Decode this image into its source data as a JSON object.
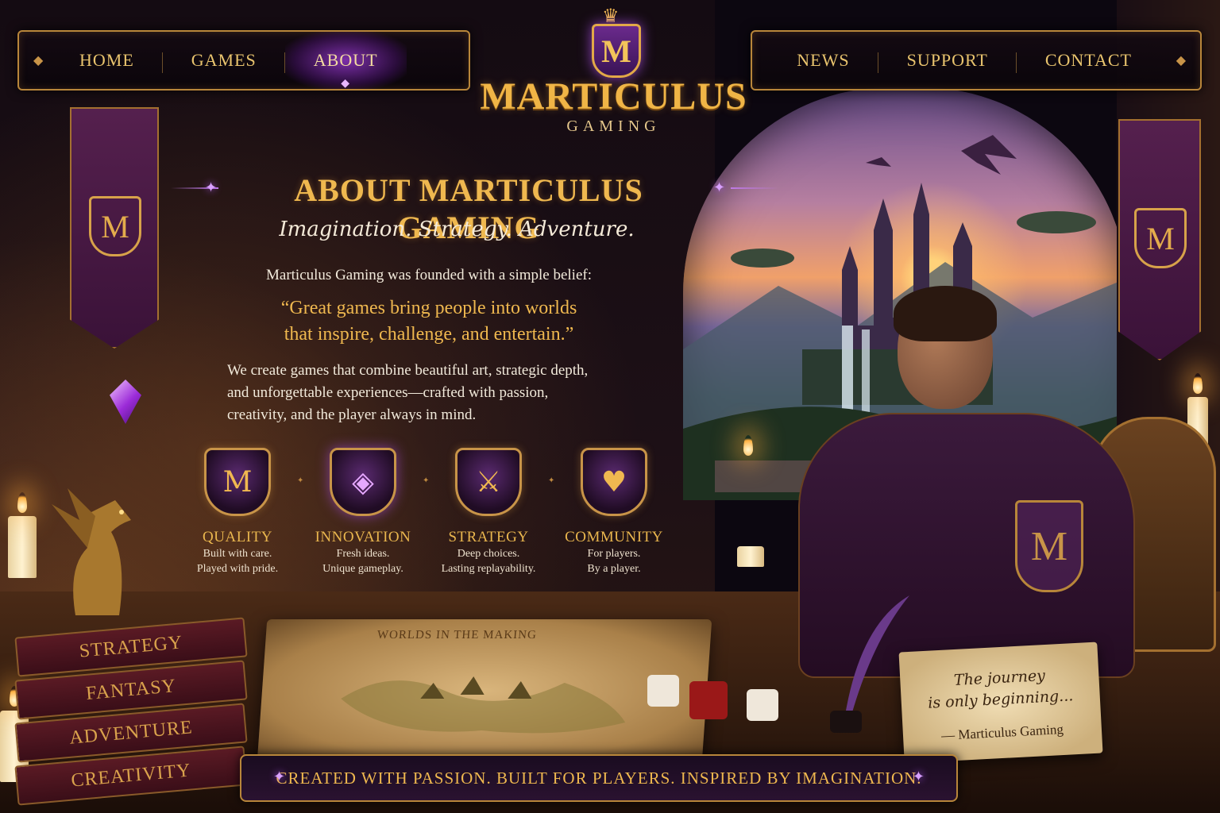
{
  "nav": {
    "left": [
      "HOME",
      "GAMES",
      "ABOUT"
    ],
    "right": [
      "NEWS",
      "SUPPORT",
      "CONTACT"
    ],
    "active": "ABOUT"
  },
  "logo": {
    "emblem_letter": "M",
    "title": "MARTICULUS",
    "subtitle": "GAMING"
  },
  "about": {
    "title": "ABOUT MARTICULUS GAMING",
    "tagline": "Imagination. Strategy. Adventure.",
    "intro": "Marticulus Gaming was founded with a simple belief:",
    "quote_line1": "“Great games bring people into worlds",
    "quote_line2": "that inspire, challenge, and entertain.”",
    "body_line1": "We create games that combine beautiful art, strategic depth,",
    "body_line2": "and unforgettable experiences—crafted with passion,",
    "body_line3": "creativity, and the player always in mind."
  },
  "features": [
    {
      "icon": "crest-m-icon",
      "title": "QUALITY",
      "line1": "Built with care.",
      "line2": "Played with pride."
    },
    {
      "icon": "crystal-orb-icon",
      "title": "INNOVATION",
      "line1": "Fresh ideas.",
      "line2": "Unique gameplay."
    },
    {
      "icon": "crossed-swords-icon",
      "title": "STRATEGY",
      "line1": "Deep choices.",
      "line2": "Lasting replayability."
    },
    {
      "icon": "heart-handshake-icon",
      "title": "COMMUNITY",
      "line1": "For players.",
      "line2": "By a player."
    }
  ],
  "banners": {
    "letter": "M"
  },
  "books": [
    "STRATEGY",
    "FANTASY",
    "ADVENTURE",
    "CREATIVITY"
  ],
  "map": {
    "title": "WORLDS IN THE MAKING"
  },
  "cape": {
    "letter": "M"
  },
  "note": {
    "line1": "The journey",
    "line2": "is only beginning...",
    "signature": "— Marticulus Gaming"
  },
  "footer": {
    "text": "Created with passion.  Built for players.  Inspired by imagination."
  },
  "colors": {
    "gold": "#efb84f",
    "purple_glow": "#b45cff",
    "background": "#0c0710"
  }
}
